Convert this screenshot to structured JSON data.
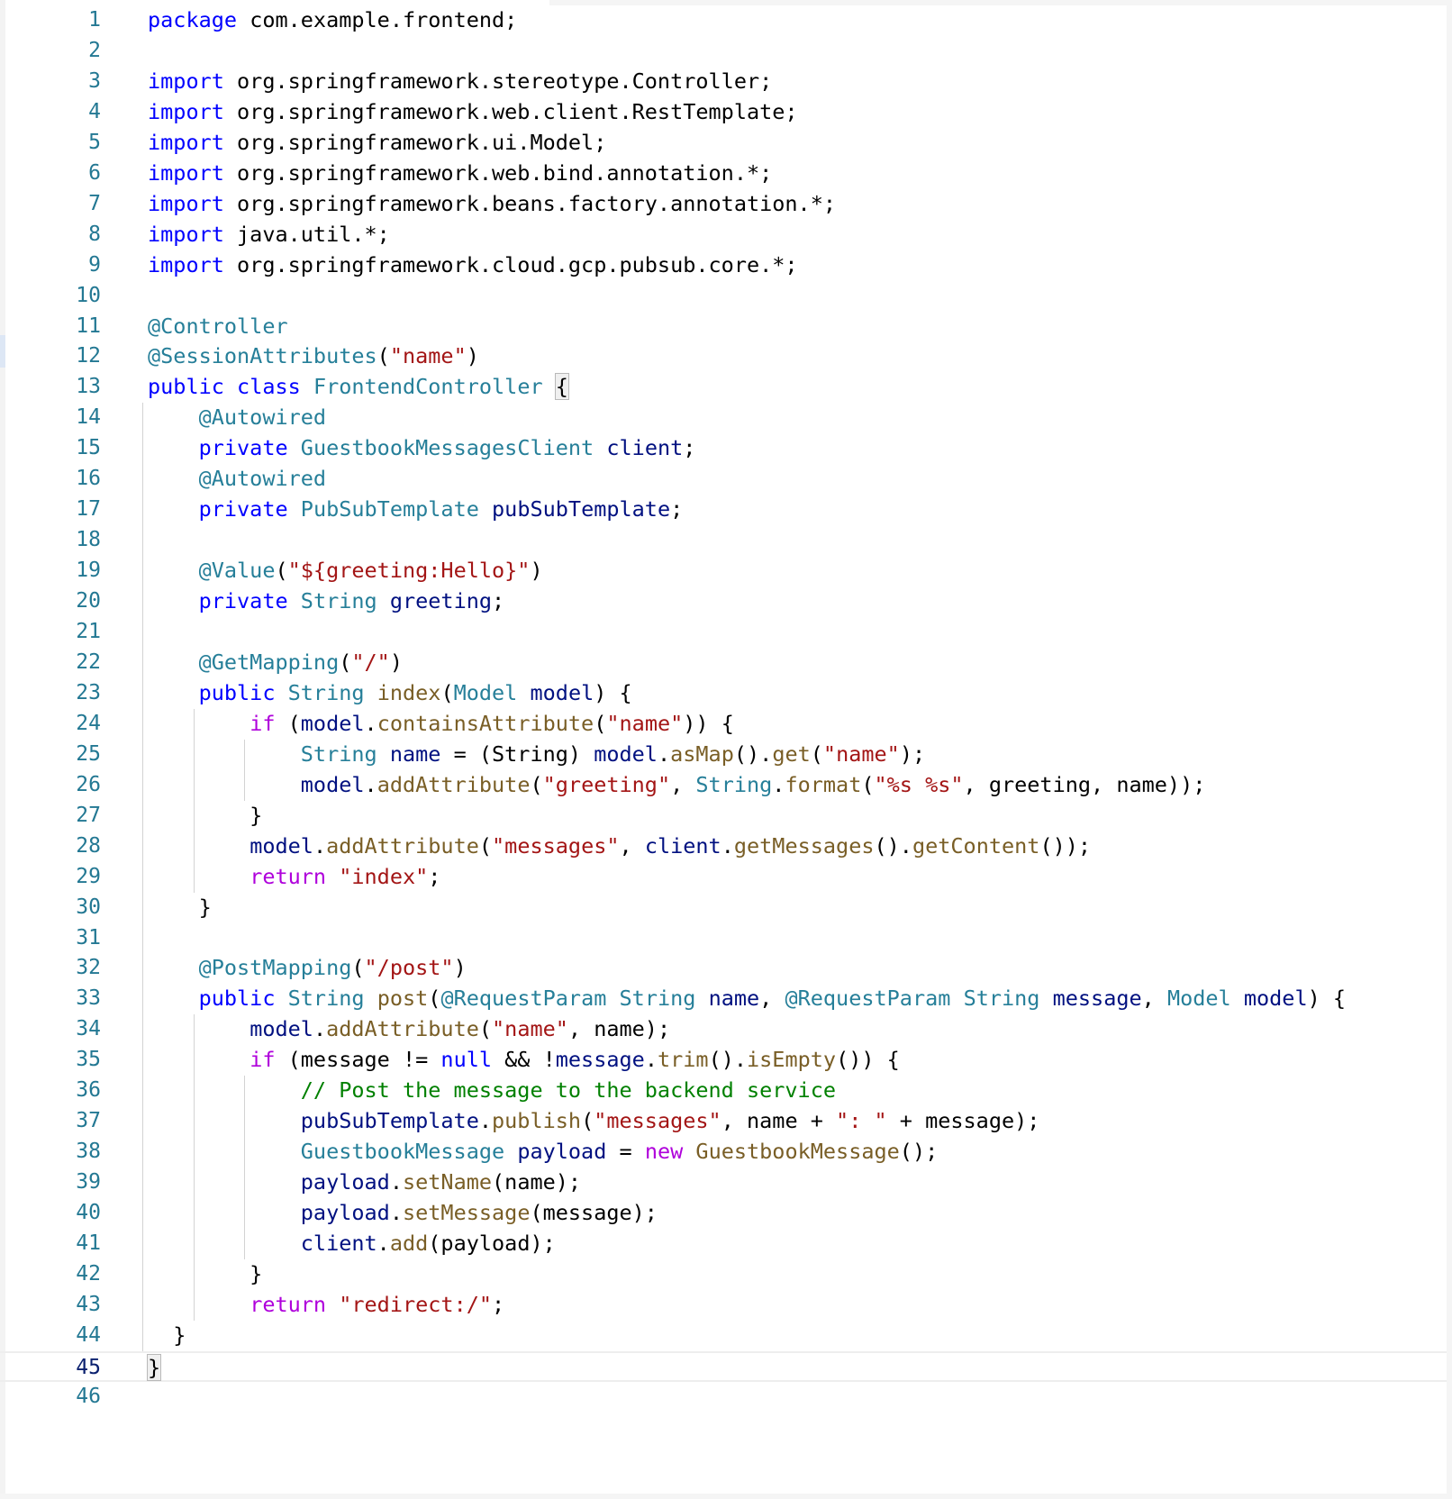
{
  "editor": {
    "language": "java",
    "active_line": 45,
    "colors": {
      "keyword": "#0000ff",
      "control": "#af00db",
      "type_annotation": "#267f99",
      "string": "#a31515",
      "variable": "#001080",
      "function": "#795e26",
      "comment": "#008000",
      "line_number": "#237893"
    },
    "lines": [
      {
        "n": "1",
        "tokens": [
          [
            "package",
            "k"
          ],
          [
            " com.example.frontend;",
            ""
          ]
        ]
      },
      {
        "n": "2",
        "tokens": []
      },
      {
        "n": "3",
        "tokens": [
          [
            "import",
            "k"
          ],
          [
            " org.springframework.stereotype.Controller;",
            ""
          ]
        ]
      },
      {
        "n": "4",
        "tokens": [
          [
            "import",
            "k"
          ],
          [
            " org.springframework.web.client.RestTemplate;",
            ""
          ]
        ]
      },
      {
        "n": "5",
        "tokens": [
          [
            "import",
            "k"
          ],
          [
            " org.springframework.ui.Model;",
            ""
          ]
        ]
      },
      {
        "n": "6",
        "tokens": [
          [
            "import",
            "k"
          ],
          [
            " org.springframework.web.bind.annotation.*;",
            ""
          ]
        ]
      },
      {
        "n": "7",
        "tokens": [
          [
            "import",
            "k"
          ],
          [
            " org.springframework.beans.factory.annotation.*;",
            ""
          ]
        ]
      },
      {
        "n": "8",
        "tokens": [
          [
            "import",
            "k"
          ],
          [
            " java.util.*;",
            ""
          ]
        ]
      },
      {
        "n": "9",
        "tokens": [
          [
            "import",
            "k"
          ],
          [
            " org.springframework.cloud.gcp.pubsub.core.*;",
            ""
          ]
        ]
      },
      {
        "n": "10",
        "tokens": []
      },
      {
        "n": "11",
        "tokens": [
          [
            "@Controller",
            "a"
          ]
        ]
      },
      {
        "n": "12",
        "tokens": [
          [
            "@SessionAttributes",
            "a"
          ],
          [
            "(",
            ""
          ],
          [
            "\"name\"",
            "s"
          ],
          [
            ")",
            ""
          ]
        ]
      },
      {
        "n": "13",
        "tokens": [
          [
            "public",
            "k"
          ],
          [
            " ",
            ""
          ],
          [
            "class",
            "k"
          ],
          [
            " ",
            ""
          ],
          [
            "FrontendController",
            "t"
          ],
          [
            " ",
            ""
          ],
          [
            "{",
            "bm"
          ]
        ]
      },
      {
        "n": "14",
        "tokens": [
          [
            "    ",
            ""
          ],
          [
            "@Autowired",
            "a"
          ]
        ]
      },
      {
        "n": "15",
        "tokens": [
          [
            "    ",
            ""
          ],
          [
            "private",
            "k"
          ],
          [
            " ",
            ""
          ],
          [
            "GuestbookMessagesClient",
            "t"
          ],
          [
            " ",
            ""
          ],
          [
            "client",
            "v"
          ],
          [
            ";",
            ""
          ]
        ]
      },
      {
        "n": "16",
        "tokens": [
          [
            "    ",
            ""
          ],
          [
            "@Autowired",
            "a"
          ]
        ]
      },
      {
        "n": "17",
        "tokens": [
          [
            "    ",
            ""
          ],
          [
            "private",
            "k"
          ],
          [
            " ",
            ""
          ],
          [
            "PubSubTemplate",
            "t"
          ],
          [
            " ",
            ""
          ],
          [
            "pubSubTemplate",
            "v"
          ],
          [
            ";",
            ""
          ]
        ]
      },
      {
        "n": "18",
        "tokens": []
      },
      {
        "n": "19",
        "tokens": [
          [
            "    ",
            ""
          ],
          [
            "@Value",
            "a"
          ],
          [
            "(",
            ""
          ],
          [
            "\"${greeting:Hello}\"",
            "s"
          ],
          [
            ")",
            ""
          ]
        ]
      },
      {
        "n": "20",
        "tokens": [
          [
            "    ",
            ""
          ],
          [
            "private",
            "k"
          ],
          [
            " ",
            ""
          ],
          [
            "String",
            "t"
          ],
          [
            " ",
            ""
          ],
          [
            "greeting",
            "v"
          ],
          [
            ";",
            ""
          ]
        ]
      },
      {
        "n": "21",
        "tokens": []
      },
      {
        "n": "22",
        "tokens": [
          [
            "    ",
            ""
          ],
          [
            "@GetMapping",
            "a"
          ],
          [
            "(",
            ""
          ],
          [
            "\"/\"",
            "s"
          ],
          [
            ")",
            ""
          ]
        ]
      },
      {
        "n": "23",
        "tokens": [
          [
            "    ",
            ""
          ],
          [
            "public",
            "k"
          ],
          [
            " ",
            ""
          ],
          [
            "String",
            "t"
          ],
          [
            " ",
            ""
          ],
          [
            "index",
            "f"
          ],
          [
            "(",
            ""
          ],
          [
            "Model",
            "t"
          ],
          [
            " ",
            ""
          ],
          [
            "model",
            "v"
          ],
          [
            ") {",
            ""
          ]
        ]
      },
      {
        "n": "24",
        "tokens": [
          [
            "        ",
            ""
          ],
          [
            "if",
            "ctl"
          ],
          [
            " (",
            ""
          ],
          [
            "model",
            "v"
          ],
          [
            ".",
            ""
          ],
          [
            "containsAttribute",
            "f"
          ],
          [
            "(",
            ""
          ],
          [
            "\"name\"",
            "s"
          ],
          [
            ")) {",
            ""
          ]
        ]
      },
      {
        "n": "25",
        "tokens": [
          [
            "            ",
            ""
          ],
          [
            "String",
            "t"
          ],
          [
            " ",
            ""
          ],
          [
            "name",
            "v"
          ],
          [
            " = (String) ",
            ""
          ],
          [
            "model",
            "v"
          ],
          [
            ".",
            ""
          ],
          [
            "asMap",
            "f"
          ],
          [
            "().",
            ""
          ],
          [
            "get",
            "f"
          ],
          [
            "(",
            ""
          ],
          [
            "\"name\"",
            "s"
          ],
          [
            ");",
            ""
          ]
        ]
      },
      {
        "n": "26",
        "tokens": [
          [
            "            ",
            ""
          ],
          [
            "model",
            "v"
          ],
          [
            ".",
            ""
          ],
          [
            "addAttribute",
            "f"
          ],
          [
            "(",
            ""
          ],
          [
            "\"greeting\"",
            "s"
          ],
          [
            ", ",
            ""
          ],
          [
            "String",
            "t"
          ],
          [
            ".",
            ""
          ],
          [
            "format",
            "f"
          ],
          [
            "(",
            ""
          ],
          [
            "\"%s %s\"",
            "s"
          ],
          [
            ", greeting, name));",
            ""
          ]
        ]
      },
      {
        "n": "27",
        "tokens": [
          [
            "        }",
            ""
          ]
        ]
      },
      {
        "n": "28",
        "tokens": [
          [
            "        ",
            ""
          ],
          [
            "model",
            "v"
          ],
          [
            ".",
            ""
          ],
          [
            "addAttribute",
            "f"
          ],
          [
            "(",
            ""
          ],
          [
            "\"messages\"",
            "s"
          ],
          [
            ", ",
            ""
          ],
          [
            "client",
            "v"
          ],
          [
            ".",
            ""
          ],
          [
            "getMessages",
            "f"
          ],
          [
            "().",
            ""
          ],
          [
            "getContent",
            "f"
          ],
          [
            "());",
            ""
          ]
        ]
      },
      {
        "n": "29",
        "tokens": [
          [
            "        ",
            ""
          ],
          [
            "return",
            "ctl"
          ],
          [
            " ",
            ""
          ],
          [
            "\"index\"",
            "s"
          ],
          [
            ";",
            ""
          ]
        ]
      },
      {
        "n": "30",
        "tokens": [
          [
            "    }",
            ""
          ]
        ]
      },
      {
        "n": "31",
        "tokens": []
      },
      {
        "n": "32",
        "tokens": [
          [
            "    ",
            ""
          ],
          [
            "@PostMapping",
            "a"
          ],
          [
            "(",
            ""
          ],
          [
            "\"/post\"",
            "s"
          ],
          [
            ")",
            ""
          ]
        ]
      },
      {
        "n": "33",
        "tokens": [
          [
            "    ",
            ""
          ],
          [
            "public",
            "k"
          ],
          [
            " ",
            ""
          ],
          [
            "String",
            "t"
          ],
          [
            " ",
            ""
          ],
          [
            "post",
            "f"
          ],
          [
            "(",
            ""
          ],
          [
            "@RequestParam",
            "a"
          ],
          [
            " ",
            ""
          ],
          [
            "String",
            "t"
          ],
          [
            " ",
            ""
          ],
          [
            "name",
            "v"
          ],
          [
            ", ",
            ""
          ],
          [
            "@RequestParam",
            "a"
          ],
          [
            " ",
            ""
          ],
          [
            "String",
            "t"
          ],
          [
            " ",
            ""
          ],
          [
            "message",
            "v"
          ],
          [
            ", ",
            ""
          ],
          [
            "Model",
            "t"
          ],
          [
            " ",
            ""
          ],
          [
            "model",
            "v"
          ],
          [
            ") {",
            ""
          ]
        ]
      },
      {
        "n": "34",
        "tokens": [
          [
            "        ",
            ""
          ],
          [
            "model",
            "v"
          ],
          [
            ".",
            ""
          ],
          [
            "addAttribute",
            "f"
          ],
          [
            "(",
            ""
          ],
          [
            "\"name\"",
            "s"
          ],
          [
            ", name);",
            ""
          ]
        ]
      },
      {
        "n": "35",
        "tokens": [
          [
            "        ",
            ""
          ],
          [
            "if",
            "ctl"
          ],
          [
            " (message != ",
            ""
          ],
          [
            "null",
            "k"
          ],
          [
            " && !",
            ""
          ],
          [
            "message",
            "v"
          ],
          [
            ".",
            ""
          ],
          [
            "trim",
            "f"
          ],
          [
            "().",
            ""
          ],
          [
            "isEmpty",
            "f"
          ],
          [
            "()) {",
            ""
          ]
        ]
      },
      {
        "n": "36",
        "tokens": [
          [
            "            ",
            ""
          ],
          [
            "// Post the message to the backend service",
            "c"
          ]
        ]
      },
      {
        "n": "37",
        "tokens": [
          [
            "            ",
            ""
          ],
          [
            "pubSubTemplate",
            "v"
          ],
          [
            ".",
            ""
          ],
          [
            "publish",
            "f"
          ],
          [
            "(",
            ""
          ],
          [
            "\"messages\"",
            "s"
          ],
          [
            ", name + ",
            ""
          ],
          [
            "\": \"",
            "s"
          ],
          [
            " + message);",
            ""
          ]
        ]
      },
      {
        "n": "38",
        "tokens": [
          [
            "            ",
            ""
          ],
          [
            "GuestbookMessage",
            "t"
          ],
          [
            " ",
            ""
          ],
          [
            "payload",
            "v"
          ],
          [
            " = ",
            ""
          ],
          [
            "new",
            "ctl"
          ],
          [
            " ",
            ""
          ],
          [
            "GuestbookMessage",
            "f"
          ],
          [
            "();",
            ""
          ]
        ]
      },
      {
        "n": "39",
        "tokens": [
          [
            "            ",
            ""
          ],
          [
            "payload",
            "v"
          ],
          [
            ".",
            ""
          ],
          [
            "setName",
            "f"
          ],
          [
            "(name);",
            ""
          ]
        ]
      },
      {
        "n": "40",
        "tokens": [
          [
            "            ",
            ""
          ],
          [
            "payload",
            "v"
          ],
          [
            ".",
            ""
          ],
          [
            "setMessage",
            "f"
          ],
          [
            "(message);",
            ""
          ]
        ]
      },
      {
        "n": "41",
        "tokens": [
          [
            "            ",
            ""
          ],
          [
            "client",
            "v"
          ],
          [
            ".",
            ""
          ],
          [
            "add",
            "f"
          ],
          [
            "(payload);",
            ""
          ]
        ]
      },
      {
        "n": "42",
        "tokens": [
          [
            "        }",
            ""
          ]
        ]
      },
      {
        "n": "43",
        "tokens": [
          [
            "        ",
            ""
          ],
          [
            "return",
            "ctl"
          ],
          [
            " ",
            ""
          ],
          [
            "\"redirect:/\"",
            "s"
          ],
          [
            ";",
            ""
          ]
        ]
      },
      {
        "n": "44",
        "tokens": [
          [
            "  }",
            ""
          ]
        ]
      },
      {
        "n": "45",
        "tokens": [
          [
            "}",
            "bm"
          ]
        ]
      },
      {
        "n": "46",
        "tokens": []
      }
    ]
  }
}
